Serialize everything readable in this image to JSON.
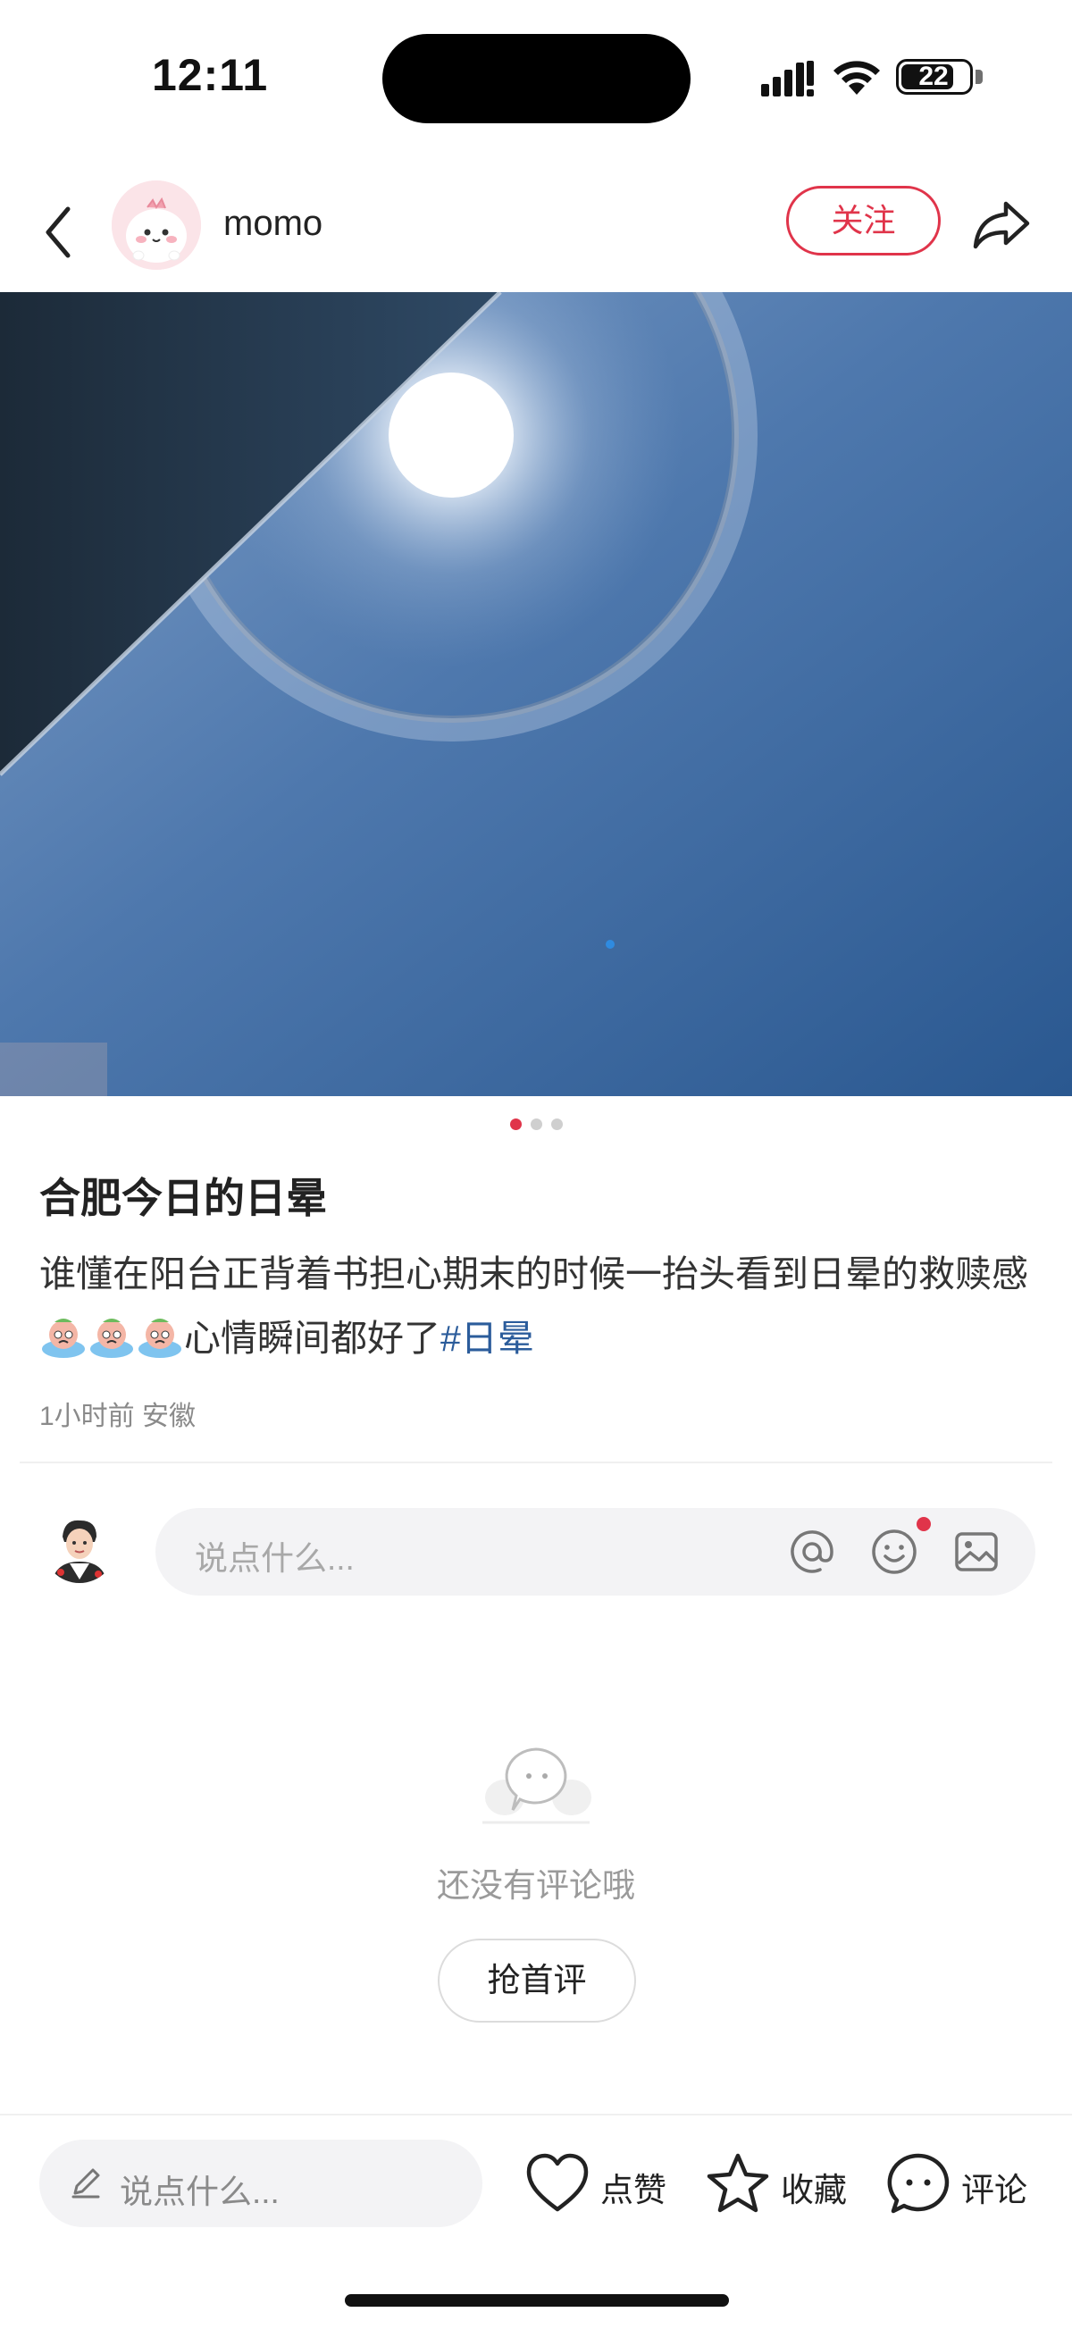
{
  "status_bar": {
    "time": "12:11",
    "battery": "22"
  },
  "header": {
    "username": "momo",
    "follow_label": "关注"
  },
  "carousel": {
    "total": 3,
    "active": 1
  },
  "post": {
    "title": "合肥今日的日晕",
    "body_text": "谁懂在阳台正背着书担心期末的时候一抬头看到日晕的救赎感",
    "body_after_emoji": "心情瞬间都好了",
    "hashtag": "#日晕",
    "meta": "1小时前 安徽"
  },
  "comment_box": {
    "placeholder": "说点什么..."
  },
  "empty_state": {
    "text": "还没有评论哦",
    "button_label": "抢首评"
  },
  "bottom_bar": {
    "input_placeholder": "说点什么...",
    "like_label": "点赞",
    "collect_label": "收藏",
    "comment_label": "评论"
  },
  "colors": {
    "accent": "#e0344a",
    "hashtag": "#2b5c9b",
    "sky_top": "#5d86b8",
    "sky_bottom": "#2f5d96"
  },
  "icons": [
    "back-icon",
    "share-icon",
    "at-icon",
    "emoji-icon",
    "image-icon",
    "pen-icon",
    "heart-icon",
    "star-icon",
    "comment-bubble-icon",
    "empty-comment-icon"
  ]
}
